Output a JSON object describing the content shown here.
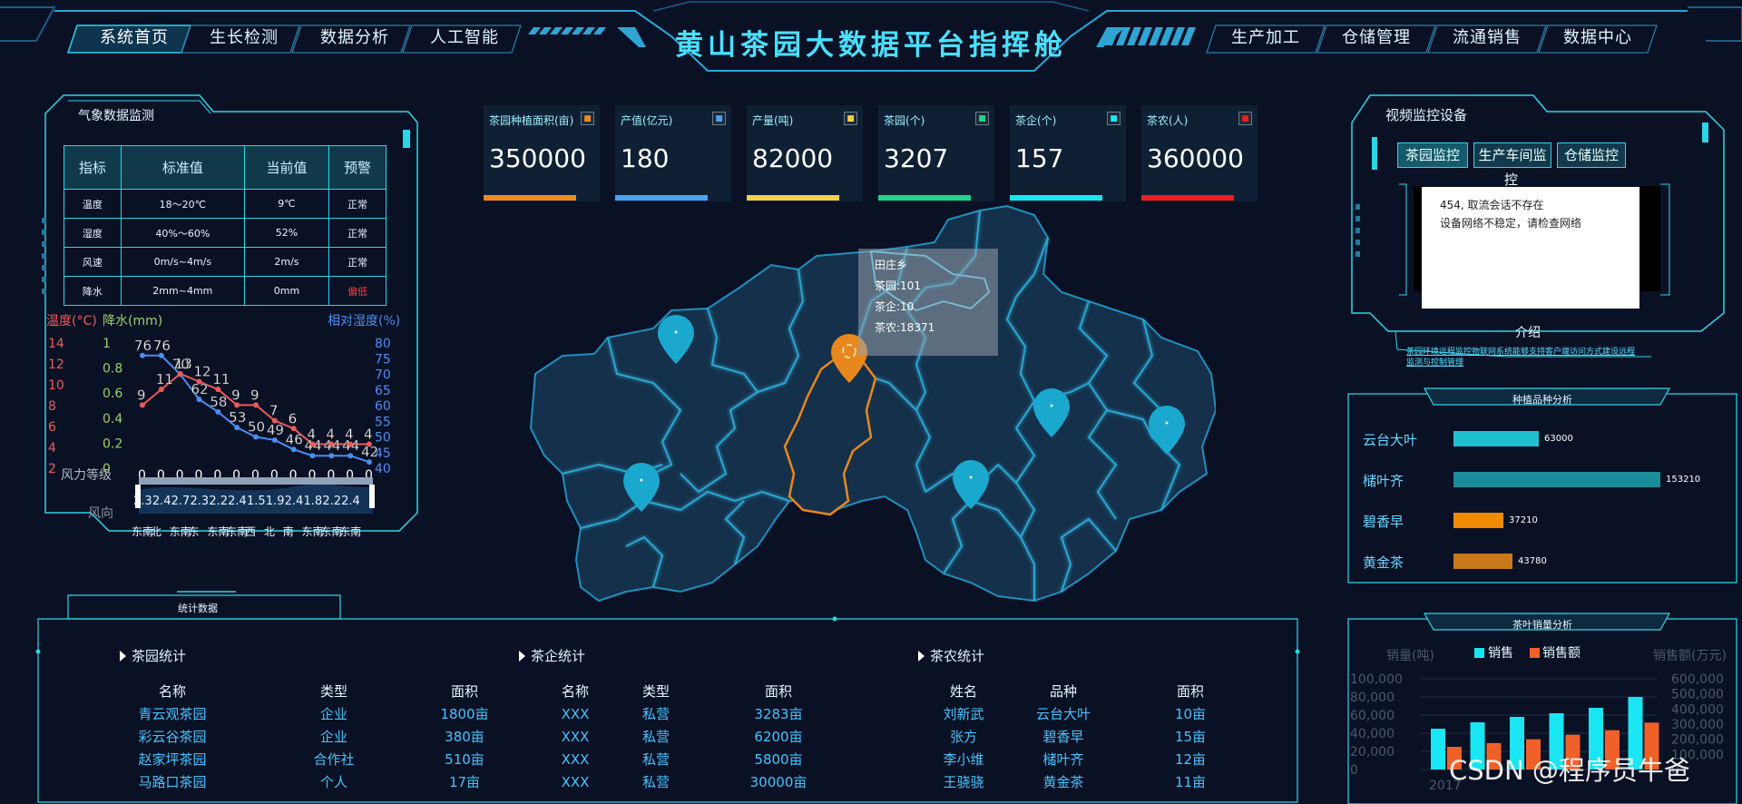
{
  "header": {
    "title": "黄山茶园大数据平台指挥舱",
    "left_tabs": [
      "系统首页",
      "生长检测",
      "数据分析",
      "人工智能"
    ],
    "right_tabs": [
      "生产加工",
      "仓储管理",
      "流通销售",
      "数据中心"
    ],
    "active_tab": "系统首页"
  },
  "weather": {
    "title": "气象数据监测",
    "columns": [
      "指标",
      "标准值",
      "当前值",
      "预警"
    ],
    "rows": [
      {
        "name": "温度",
        "standard": "18～20℃",
        "current": "9℃",
        "warn": "正常",
        "alert": false
      },
      {
        "name": "湿度",
        "standard": "40%～60%",
        "current": "52%",
        "warn": "正常",
        "alert": false
      },
      {
        "name": "风速",
        "standard": "0m/s~4m/s",
        "current": "2m/s",
        "warn": "正常",
        "alert": false
      },
      {
        "name": "降水",
        "standard": "2mm~4mm",
        "current": "0mm",
        "warn": "偏低",
        "alert": true
      }
    ]
  },
  "chart_data": {
    "type": "line",
    "legend_labels": [
      "温度(°C)",
      "降水(mm)",
      "相对湿度(%)"
    ],
    "axis_left_temp": [
      "14",
      "12",
      "10",
      "8",
      "6",
      "4",
      "2"
    ],
    "axis_left_rain": [
      "1",
      "0.8",
      "0.6",
      "0.4",
      "0.2",
      "0"
    ],
    "axis_right_hum": [
      "80",
      "75",
      "70",
      "65",
      "60",
      "55",
      "50",
      "45",
      "40"
    ],
    "series": [
      {
        "name": "温度(°C)",
        "values": [
          9,
          11,
          13,
          12,
          11,
          9,
          9,
          7,
          6,
          4,
          4,
          4,
          4
        ],
        "color": "#ee5a5a"
      },
      {
        "name": "相对湿度(%)",
        "values": [
          76,
          76,
          70,
          62,
          58,
          53,
          50,
          49,
          46,
          44,
          44,
          44,
          42
        ],
        "color": "#4a8ef0"
      },
      {
        "name": "降水(mm)",
        "values": [
          0,
          0,
          0,
          0,
          0,
          0,
          0,
          0,
          0,
          0,
          0,
          0,
          0
        ],
        "color": "#9ad06a"
      }
    ],
    "wind_level_label": "风力等级",
    "wind_speed_labels": [
      "2.3",
      "2.4",
      "2.7",
      "2.3",
      "2.2",
      "2.4",
      "1.5",
      "1.9",
      "2.4",
      "1.8",
      "2.2",
      "2.4"
    ],
    "wind_dir_label": "风向",
    "wind_dirs": [
      "东南",
      "北",
      "东南",
      "东",
      "东南",
      "东南",
      "西",
      "北",
      "南",
      "东南",
      "东南",
      "东南"
    ]
  },
  "kpis": [
    {
      "label": "茶园种植面积(亩)",
      "value": "350000",
      "color": "#f08a1e",
      "icon": "tea-leaf-icon"
    },
    {
      "label": "产值(亿元)",
      "value": "180",
      "color": "#4aa3f0",
      "icon": "coin-icon"
    },
    {
      "label": "产量(吨)",
      "value": "82000",
      "color": "#f3d04a",
      "icon": "globe-icon"
    },
    {
      "label": "茶园(个)",
      "value": "3207",
      "color": "#22d48a",
      "icon": "plant-icon"
    },
    {
      "label": "茶企(个)",
      "value": "157",
      "color": "#19e6f2",
      "icon": "building-icon"
    },
    {
      "label": "茶农(人)",
      "value": "360000",
      "color": "#f01c1c",
      "icon": "farmer-icon"
    }
  ],
  "map": {
    "tooltip": {
      "title": "田庄乡",
      "line1": "茶园:101",
      "line2": "茶企:10",
      "line3": "茶农:18371"
    }
  },
  "video": {
    "title": "视频监控设备",
    "tabs": [
      "茶园监控",
      "生产车间监",
      "仓储监控"
    ],
    "subtitle": "控",
    "msg1": "454, 取流会话不存在",
    "msg2": "设备网络不稳定，请检查网络",
    "intro_title": "介绍",
    "intro_text1": "茶园环境远程监控物联网系统能够支持客户端访问方式建设远程",
    "intro_text2": "监测与控制管理"
  },
  "varieties": {
    "title": "种植品种分析",
    "items": [
      {
        "name": "云台大叶",
        "value": 63000,
        "label": "63000",
        "color": "#1fc1d1"
      },
      {
        "name": "槠叶齐",
        "value": 153210,
        "label": "153210",
        "color": "#1a8c9a"
      },
      {
        "name": "碧香早",
        "value": 37210,
        "label": "37210",
        "color": "#f08a00"
      },
      {
        "name": "黄金茶",
        "value": 43780,
        "label": "43780",
        "color": "#c87a1a"
      }
    ]
  },
  "sales": {
    "title": "茶叶销量分析",
    "y_left_label": "销量(吨)",
    "y_right_label": "销售额(万元)",
    "legend": [
      "销售",
      "销售额"
    ],
    "y_left": [
      "100,000",
      "80,000",
      "60,000",
      "40,000",
      "20,000",
      "0"
    ],
    "y_right": [
      "600,000",
      "500,000",
      "400,000",
      "300,000",
      "200,000",
      "100,000",
      "0"
    ],
    "x_labels": [
      "2017",
      "",
      "",
      "",
      "",
      ""
    ],
    "sales": [
      45000,
      52000,
      58000,
      62000,
      68000,
      80000
    ],
    "revenue": [
      150000,
      175000,
      200000,
      230000,
      260000,
      310000
    ]
  },
  "stats": {
    "title": "统计数据",
    "garden": {
      "title": "茶园统计",
      "headers": [
        "名称",
        "类型",
        "面积"
      ],
      "rows": [
        [
          "青云观茶园",
          "企业",
          "1800亩"
        ],
        [
          "彩云谷茶园",
          "企业",
          "380亩"
        ],
        [
          "赵家坪茶园",
          "合作社",
          "510亩"
        ],
        [
          "马路口茶园",
          "个人",
          "17亩"
        ]
      ]
    },
    "company": {
      "title": "茶企统计",
      "headers": [
        "名称",
        "类型",
        "面积"
      ],
      "rows": [
        [
          "XXX",
          "私营",
          "3283亩"
        ],
        [
          "XXX",
          "私营",
          "6200亩"
        ],
        [
          "XXX",
          "私营",
          "5800亩"
        ],
        [
          "XXX",
          "私营",
          "30000亩"
        ]
      ]
    },
    "farmer": {
      "title": "茶农统计",
      "headers": [
        "姓名",
        "品种",
        "面积"
      ],
      "rows": [
        [
          "刘新武",
          "云台大叶",
          "10亩"
        ],
        [
          "张方",
          "碧香早",
          "15亩"
        ],
        [
          "李小维",
          "槠叶齐",
          "12亩"
        ],
        [
          "王骁骁",
          "黄金茶",
          "11亩"
        ]
      ]
    }
  },
  "watermark": "CSDN @程序员牛爸"
}
